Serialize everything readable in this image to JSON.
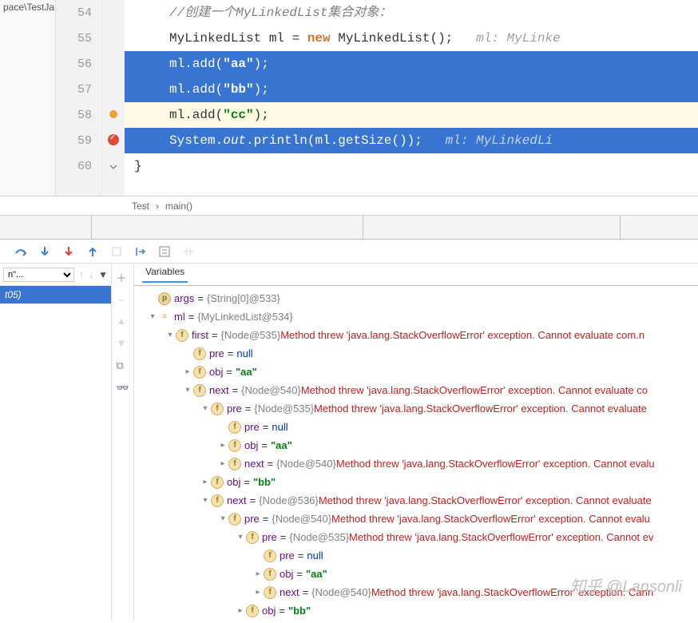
{
  "leftPanel": {
    "text": "pace\\TestJa..."
  },
  "gutter": [
    "54",
    "55",
    "56",
    "57",
    "58",
    "59",
    "60"
  ],
  "code": {
    "l54_comment": "//创建一个MyLinkedList集合对象：",
    "l55_a": "MyLinkedList ml = ",
    "l55_new": "new",
    "l55_b": " MyLinkedList();   ",
    "l55_hint": "ml: MyLinke",
    "l56_a": "ml.add(",
    "l56_s": "\"aa\"",
    "l56_b": ");",
    "l57_a": "ml.add(",
    "l57_s": "\"bb\"",
    "l57_b": ");",
    "l58_a": "ml.add(",
    "l58_s": "\"cc\"",
    "l58_b": ");",
    "l59_a": "System.",
    "l59_out": "out",
    "l59_b": ".println(ml.getSize());   ",
    "l59_hint": "ml: MyLinkedLi",
    "l60": "}"
  },
  "breadcrumb": {
    "a": "Test",
    "sep": "›",
    "b": "main()"
  },
  "toolbar": {},
  "frames": {
    "dropdown": "n\"...",
    "item": "t05)"
  },
  "varsTab": "Variables",
  "tree": [
    {
      "indent": 0,
      "arrow": "",
      "icon": "p",
      "name": "args",
      "eq": "=",
      "gray": "{String[0]@533}",
      "err": "",
      "val": ""
    },
    {
      "indent": 0,
      "arrow": "▾",
      "icon": "eq",
      "name": "ml",
      "eq": "=",
      "gray": "{MyLinkedList@534}",
      "err": "",
      "val": ""
    },
    {
      "indent": 1,
      "arrow": "▾",
      "icon": "f",
      "name": "first",
      "eq": "=",
      "gray": "{Node@535}",
      "err": " Method threw 'java.lang.StackOverflowError' exception. Cannot evaluate com.n",
      "val": ""
    },
    {
      "indent": 2,
      "arrow": "",
      "icon": "f",
      "name": "pre",
      "eq": "=",
      "gray": "",
      "err": "",
      "val": "null",
      "valClass": "var-null"
    },
    {
      "indent": 2,
      "arrow": "▸",
      "icon": "f",
      "name": "obj",
      "eq": "=",
      "gray": "",
      "err": "",
      "val": "\"aa\"",
      "valClass": "var-green"
    },
    {
      "indent": 2,
      "arrow": "▾",
      "icon": "f",
      "name": "next",
      "eq": "=",
      "gray": "{Node@540}",
      "err": " Method threw 'java.lang.StackOverflowError' exception. Cannot evaluate co",
      "val": ""
    },
    {
      "indent": 3,
      "arrow": "▾",
      "icon": "f",
      "name": "pre",
      "eq": "=",
      "gray": "{Node@535}",
      "err": " Method threw 'java.lang.StackOverflowError' exception. Cannot evaluate",
      "val": ""
    },
    {
      "indent": 4,
      "arrow": "",
      "icon": "f",
      "name": "pre",
      "eq": "=",
      "gray": "",
      "err": "",
      "val": "null",
      "valClass": "var-null"
    },
    {
      "indent": 4,
      "arrow": "▸",
      "icon": "f",
      "name": "obj",
      "eq": "=",
      "gray": "",
      "err": "",
      "val": "\"aa\"",
      "valClass": "var-green"
    },
    {
      "indent": 4,
      "arrow": "▸",
      "icon": "f",
      "name": "next",
      "eq": "=",
      "gray": "{Node@540}",
      "err": " Method threw 'java.lang.StackOverflowError' exception. Cannot evalu",
      "val": ""
    },
    {
      "indent": 3,
      "arrow": "▸",
      "icon": "f",
      "name": "obj",
      "eq": "=",
      "gray": "",
      "err": "",
      "val": "\"bb\"",
      "valClass": "var-green"
    },
    {
      "indent": 3,
      "arrow": "▾",
      "icon": "f",
      "name": "next",
      "eq": "=",
      "gray": "{Node@536}",
      "err": " Method threw 'java.lang.StackOverflowError' exception. Cannot evaluate",
      "val": ""
    },
    {
      "indent": 4,
      "arrow": "▾",
      "icon": "f",
      "name": "pre",
      "eq": "=",
      "gray": "{Node@540}",
      "err": " Method threw 'java.lang.StackOverflowError' exception. Cannot evalu",
      "val": ""
    },
    {
      "indent": 5,
      "arrow": "▾",
      "icon": "f",
      "name": "pre",
      "eq": "=",
      "gray": "{Node@535}",
      "err": " Method threw 'java.lang.StackOverflowError' exception. Cannot ev",
      "val": ""
    },
    {
      "indent": 6,
      "arrow": "",
      "icon": "f",
      "name": "pre",
      "eq": "=",
      "gray": "",
      "err": "",
      "val": "null",
      "valClass": "var-null"
    },
    {
      "indent": 6,
      "arrow": "▸",
      "icon": "f",
      "name": "obj",
      "eq": "=",
      "gray": "",
      "err": "",
      "val": "\"aa\"",
      "valClass": "var-green"
    },
    {
      "indent": 6,
      "arrow": "▸",
      "icon": "f",
      "name": "next",
      "eq": "=",
      "gray": "{Node@540}",
      "err": " Method threw 'java.lang.StackOverflowError' exception. Cann",
      "val": ""
    },
    {
      "indent": 5,
      "arrow": "▸",
      "icon": "f",
      "name": "obj",
      "eq": "=",
      "gray": "",
      "err": "",
      "val": "\"bb\"",
      "valClass": "var-green"
    }
  ],
  "watermark": "知乎 @Lansonli"
}
